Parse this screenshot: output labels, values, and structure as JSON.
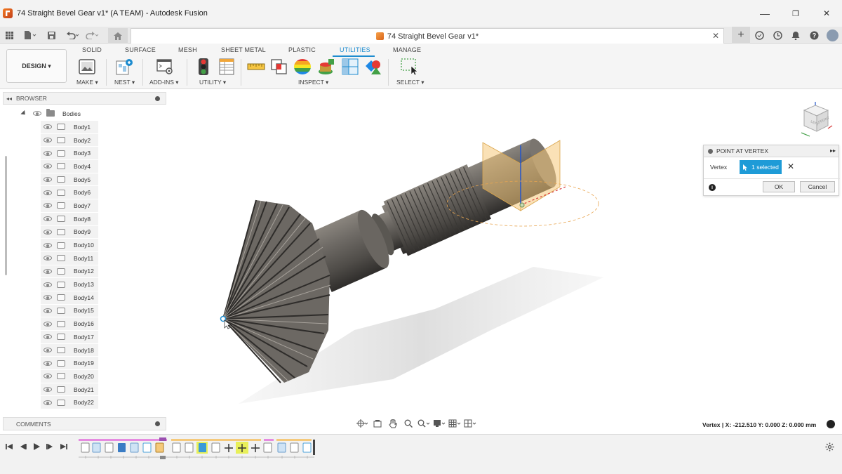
{
  "window": {
    "title": "74 Straight Bevel Gear v1* (A TEAM) - Autodesk Fusion",
    "min": "—",
    "max": "❐",
    "close": "✕"
  },
  "document_tab": {
    "title": "74 Straight Bevel Gear v1*",
    "close": "✕"
  },
  "ribbon": {
    "workspace": "DESIGN ▾",
    "tabs": [
      "SOLID",
      "SURFACE",
      "MESH",
      "SHEET METAL",
      "PLASTIC",
      "UTILITIES",
      "MANAGE"
    ],
    "active_tab": "UTILITIES",
    "groups": [
      "MAKE ▾",
      "NEST ▾",
      "ADD-INS ▾",
      "UTILITY ▾",
      "INSPECT ▾",
      "SELECT ▾"
    ]
  },
  "browser": {
    "title": "BROWSER",
    "folder": "Bodies",
    "bodies": [
      "Body1",
      "Body2",
      "Body3",
      "Body4",
      "Body5",
      "Body6",
      "Body7",
      "Body8",
      "Body9",
      "Body10",
      "Body11",
      "Body12",
      "Body13",
      "Body14",
      "Body15",
      "Body16",
      "Body17",
      "Body18",
      "Body19",
      "Body20",
      "Body21",
      "Body22"
    ]
  },
  "comments": {
    "title": "COMMENTS"
  },
  "dialog": {
    "title": "POINT AT VERTEX",
    "field_label": "Vertex",
    "selection": "1 selected",
    "ok": "OK",
    "cancel": "Cancel"
  },
  "status": {
    "coord_label": "Vertex",
    "coord_value": "| X: -212.510 Y: 0.000 Z: 0.000 mm"
  },
  "colors": {
    "accent": "#1e8ccf",
    "selection": "#1e9bd7",
    "body": "#6f6b66",
    "plane": "#f5c97a"
  }
}
